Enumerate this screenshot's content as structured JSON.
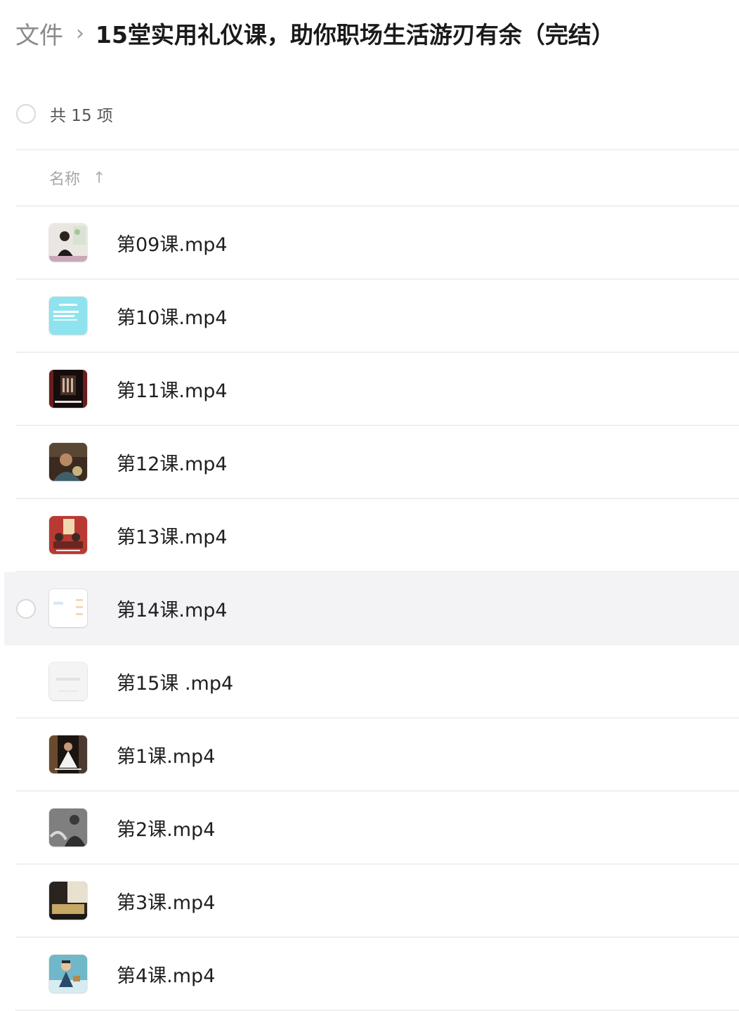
{
  "breadcrumb": {
    "root": "文件",
    "separator": "›",
    "current": "15堂实用礼仪课，助你职场生活游刃有余（完结）"
  },
  "summary": {
    "count_label": "共 15 项"
  },
  "list_header": {
    "name_label": "名称",
    "sort_icon": "↑"
  },
  "files": [
    {
      "name": "第09课.mp4",
      "thumbnail": "video-thumb-lesson-09"
    },
    {
      "name": "第10课.mp4",
      "thumbnail": "video-thumb-lesson-10"
    },
    {
      "name": "第11课.mp4",
      "thumbnail": "video-thumb-lesson-11"
    },
    {
      "name": "第12课.mp4",
      "thumbnail": "video-thumb-lesson-12"
    },
    {
      "name": "第13课.mp4",
      "thumbnail": "video-thumb-lesson-13"
    },
    {
      "name": "第14课.mp4",
      "thumbnail": "video-thumb-lesson-14",
      "hovered": true
    },
    {
      "name": "第15课 .mp4",
      "thumbnail": "video-thumb-lesson-15"
    },
    {
      "name": "第1课.mp4",
      "thumbnail": "video-thumb-lesson-1"
    },
    {
      "name": "第2课.mp4",
      "thumbnail": "video-thumb-lesson-2"
    },
    {
      "name": "第3课.mp4",
      "thumbnail": "video-thumb-lesson-3"
    },
    {
      "name": "第4课.mp4",
      "thumbnail": "video-thumb-lesson-4"
    }
  ],
  "colors": {
    "hover_row_background": "#f3f3f5",
    "divider": "#f0f0f0",
    "muted_text": "#8a8a8a"
  }
}
